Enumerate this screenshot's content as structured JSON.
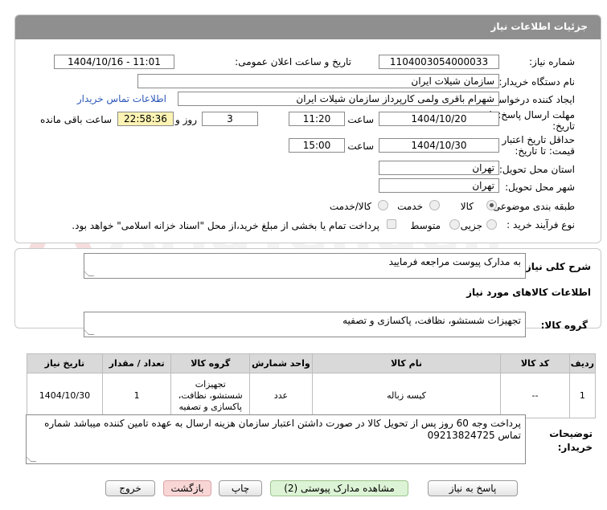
{
  "header": {
    "title": "جزئیات اطلاعات نیاز"
  },
  "fields": {
    "need_number_label": "شماره نیاز:",
    "need_number": "1104003054000033",
    "announce_label": "تاریخ و ساعت اعلان عمومی:",
    "announce_value": "1404/10/16 - 11:01",
    "buyer_org_label": "نام دستگاه خریدار:",
    "buyer_org": "سازمان شیلات ایران",
    "requester_label": "ایجاد کننده درخواست:",
    "requester": "شهرام باقری ولمی کارپرداز سازمان شیلات ایران",
    "contact_link": "اطلاعات تماس خریدار",
    "deadline_label_1": "مهلت ارسال پاسخ: تا",
    "deadline_label_2": "تاریخ:",
    "deadline_date": "1404/10/20",
    "time_label": "ساعت",
    "deadline_time": "11:20",
    "days_value": "3",
    "days_label": "روز و",
    "remaining_time": "22:58:36",
    "remaining_label": "ساعت باقی مانده",
    "validity_label_1": "حداقل تاریخ اعتبار",
    "validity_label_2": "قیمت: تا تاریخ:",
    "validity_date": "1404/10/30",
    "validity_time": "15:00",
    "province_label": "استان محل تحویل:",
    "province": "تهران",
    "city_label": "شهر محل تحویل:",
    "city": "تهران",
    "category_label": "طبقه بندی موضوعی:",
    "category_options": [
      "کالا",
      "خدمت",
      "کالا/خدمت"
    ],
    "process_label": "نوع فرآیند خرید :",
    "process_options": [
      "جزیی",
      "متوسط"
    ],
    "payment_note": "پرداخت تمام یا بخشی از مبلغ خرید،از محل \"اسناد خزانه اسلامی\" خواهد بود."
  },
  "description": {
    "label": "شرح کلی نیاز:",
    "value": "به مدارک پیوست مراجعه فرمایید"
  },
  "goods_section": {
    "title": "اطلاعات کالاهای مورد نیاز",
    "group_label": "گروه کالا:",
    "group_value": "تجهیزات شستشو، نظافت، پاکسازی و تصفیه"
  },
  "table": {
    "headers": [
      "ردیف",
      "کد کالا",
      "نام کالا",
      "واحد شمارش",
      "گروه کالا",
      "تعداد / مقدار",
      "تاریخ نیاز"
    ],
    "rows": [
      {
        "row": "1",
        "code": "--",
        "name": "کیسه زباله",
        "unit": "عدد",
        "group_l1": "تجهیزات",
        "group_l2": "شستشو، نظافت،",
        "group_l3": "پاکسازی و تصفیه",
        "qty": "1",
        "date": "1404/10/30"
      }
    ]
  },
  "buyer_notes": {
    "label_1": "توضیحات",
    "label_2": "خریدار:",
    "value": "پرداخت وجه 60 روز پس از تحویل کالا در صورت داشتن اعتبار سازمان هزینه ارسال به عهده تامین کننده میباشد شماره تماس 09213824725"
  },
  "buttons": {
    "reply": "پاسخ به نیاز",
    "attachments": "مشاهده مدارک پیوستی (2)",
    "print": "چاپ",
    "back": "بازگشت",
    "exit": "خروج"
  },
  "colors": {
    "header_bg": "#8f8f8f",
    "link": "#2c57b8",
    "remaining_bg": "#fcf3b4",
    "attachments_bg": "#dcf3d5",
    "back_bg": "#f8d6d6"
  },
  "watermark": {
    "text": "AriaTender.net"
  }
}
